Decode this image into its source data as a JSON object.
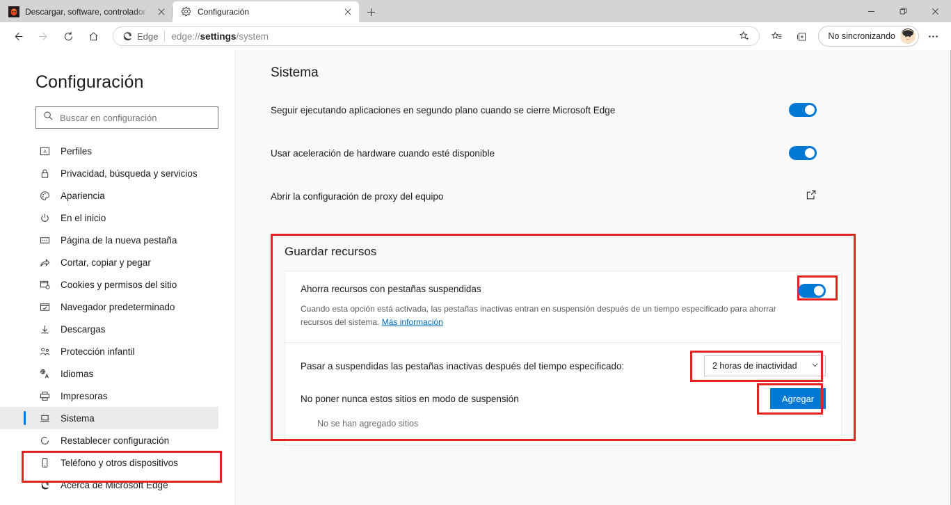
{
  "window": {
    "controls": [
      {
        "name": "minimize",
        "glyph": "—"
      },
      {
        "name": "maximize",
        "glyph": "❐"
      },
      {
        "name": "close",
        "glyph": "✕"
      }
    ]
  },
  "tabs": [
    {
      "title": "Descargar, software, controlador",
      "favicon": "site-favicon",
      "active": false,
      "close_label": "✕"
    },
    {
      "title": "Configuración",
      "favicon": "gear-icon",
      "active": true,
      "close_label": "✕"
    }
  ],
  "newtab_label": "+",
  "toolbar": {
    "back_label": "←",
    "forward_label": "→",
    "refresh_label": "↻",
    "home_label": "⌂",
    "edge_chip_label": "Edge",
    "url_prefix": "edge://",
    "url_bold": "settings",
    "url_suffix": "/system",
    "favorite_label": "☆",
    "collections_label": "⊞",
    "sync_label": "No sincronizando",
    "more_label": "···"
  },
  "sidebar": {
    "title": "Configuración",
    "search": {
      "placeholder": "Buscar en configuración",
      "value": ""
    },
    "items": [
      {
        "label": "Perfiles",
        "icon": "profile-icon",
        "selected": false
      },
      {
        "label": "Privacidad, búsqueda y servicios",
        "icon": "lock-icon",
        "selected": false
      },
      {
        "label": "Apariencia",
        "icon": "palette-icon",
        "selected": false
      },
      {
        "label": "En el inicio",
        "icon": "power-icon",
        "selected": false
      },
      {
        "label": "Página de la nueva pestaña",
        "icon": "newtab-icon",
        "selected": false
      },
      {
        "label": "Cortar, copiar y pegar",
        "icon": "share-icon",
        "selected": false
      },
      {
        "label": "Cookies y permisos del sitio",
        "icon": "cookies-icon",
        "selected": false
      },
      {
        "label": "Navegador predeterminado",
        "icon": "browser-icon",
        "selected": false
      },
      {
        "label": "Descargas",
        "icon": "download-icon",
        "selected": false
      },
      {
        "label": "Protección infantil",
        "icon": "family-icon",
        "selected": false
      },
      {
        "label": "Idiomas",
        "icon": "language-icon",
        "selected": false
      },
      {
        "label": "Impresoras",
        "icon": "printer-icon",
        "selected": false
      },
      {
        "label": "Sistema",
        "icon": "system-icon",
        "selected": true
      },
      {
        "label": "Restablecer configuración",
        "icon": "reset-icon",
        "selected": false
      },
      {
        "label": "Teléfono y otros dispositivos",
        "icon": "phone-icon",
        "selected": false
      },
      {
        "label": "Acerca de Microsoft Edge",
        "icon": "edge-icon",
        "selected": false
      }
    ]
  },
  "main": {
    "heading": "Sistema",
    "rows": [
      {
        "label": "Seguir ejecutando aplicaciones en segundo plano cuando se cierre Microsoft Edge",
        "control": "toggle",
        "state": "on"
      },
      {
        "label": "Usar aceleración de hardware cuando esté disponible",
        "control": "toggle",
        "state": "on"
      },
      {
        "label": "Abrir la configuración de proxy del equipo",
        "control": "external-link"
      }
    ],
    "save_resources": {
      "title": "Guardar recursos",
      "sleeping_tabs": {
        "title": "Ahorra recursos con pestañas suspendidas",
        "description": "Cuando esta opción está activada, las pestañas inactivas entran en suspensión después de un tiempo especificado para ahorrar recursos del sistema.",
        "link_label": "Más información",
        "state": "on"
      },
      "timeout": {
        "label": "Pasar a suspendidas las pestañas inactivas después del tiempo especificado:",
        "selected": "2 horas de inactividad",
        "chevron": "⌄"
      },
      "never_sleep": {
        "label": "No poner nunca estos sitios en modo de suspensión",
        "add_button": "Agregar",
        "empty_message": "No se han agregado sitios"
      }
    }
  },
  "colors": {
    "accent": "#0078d4",
    "annotation": "#e2231f",
    "content_bg": "#f9f9f9",
    "link": "#0067b8"
  }
}
